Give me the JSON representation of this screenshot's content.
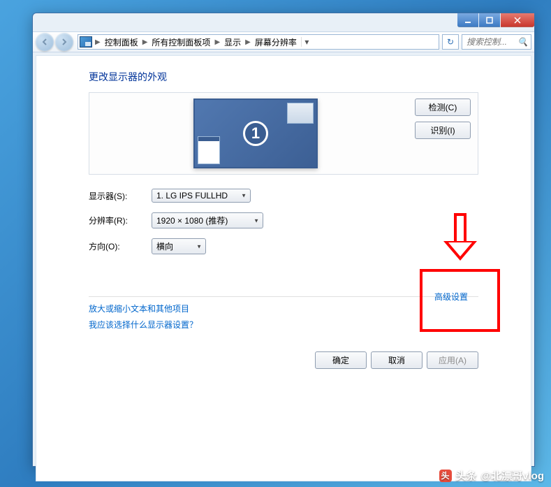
{
  "window": {
    "breadcrumbs": [
      "控制面板",
      "所有控制面板项",
      "显示",
      "屏幕分辨率"
    ],
    "search_placeholder": "搜索控制..."
  },
  "page": {
    "title": "更改显示器的外观",
    "monitor_number": "1",
    "detect_btn": "检测(C)",
    "identify_btn": "识别(I)"
  },
  "form": {
    "display_label": "显示器(S):",
    "display_value": "1. LG IPS FULLHD",
    "resolution_label": "分辨率(R):",
    "resolution_value": "1920 × 1080 (推荐)",
    "orientation_label": "方向(O):",
    "orientation_value": "横向"
  },
  "links": {
    "advanced": "高级设置",
    "text_size": "放大或缩小文本和其他项目",
    "which_display": "我应该选择什么显示器设置？"
  },
  "buttons": {
    "ok": "确定",
    "cancel": "取消",
    "apply": "应用(A)"
  },
  "watermark": {
    "prefix": "头条",
    "text": "@北漂哥vlog"
  }
}
